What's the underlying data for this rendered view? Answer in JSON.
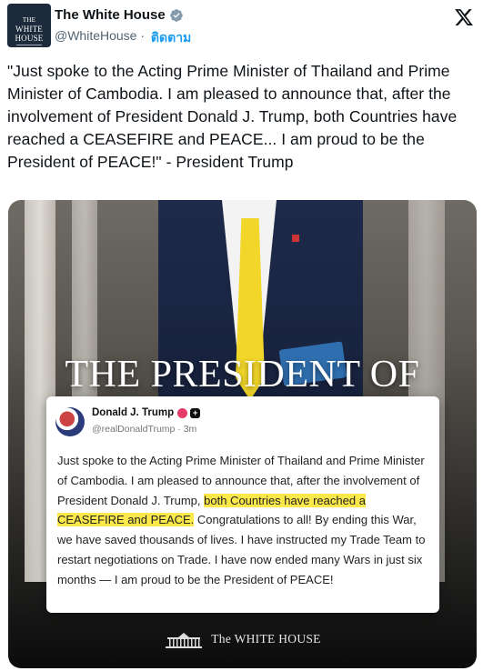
{
  "account": {
    "avatar_text_1": "THE",
    "avatar_text_2": "WHITE",
    "avatar_text_3": "HOUSE",
    "name": "The White House",
    "handle": "@WhiteHouse",
    "separator": " · ",
    "follow_label": "ติดตาม"
  },
  "tweet": {
    "text": "\"Just spoke to the Acting Prime Minister of Thailand and Prime Minister of Cambodia. I am pleased to announce that, after the involvement of President Donald J. Trump, both Countries have reached a CEASEFIRE and PEACE... I am proud to be the President of PEACE!\" - President Trump"
  },
  "media": {
    "title": "THE PRESIDENT OF PEACE",
    "card": {
      "name": "Donald J. Trump",
      "handle_time": "@realDonaldTrump · 3m",
      "body_1": "Just spoke to the Acting Prime Minister of Thailand and Prime Minister of Cambodia. I am pleased to announce that, after the involvement of President Donald J. Trump, ",
      "body_highlight": "both Countries have reached a CEASEFIRE and PEACE.",
      "body_2": " Congratulations to all! By ending this War, we have saved thousands of lives. I have instructed my Trade Team to restart negotiations on Trade. I have now ended many Wars in just six months — I am proud to be the President of PEACE!"
    },
    "footer_text": "The WHITE HOUSE"
  },
  "colors": {
    "verified": "#829aab",
    "follow": "#1d9bf0",
    "highlight": "#fbe84a"
  },
  "icons": [
    "verified-badge-icon",
    "x-logo-icon",
    "white-house-icon"
  ]
}
